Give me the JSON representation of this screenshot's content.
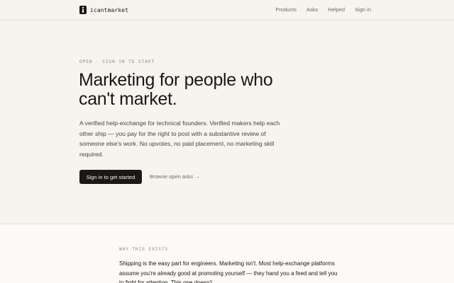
{
  "header": {
    "brand": "icantmarket",
    "logo_icon": "square-logo-icon",
    "nav": [
      {
        "label": "Products"
      },
      {
        "label": "Asks"
      },
      {
        "label": "Helped"
      },
      {
        "label": "Sign in"
      }
    ]
  },
  "hero": {
    "eyebrow": "OPEN · SIGN IN TO START",
    "headline": "Marketing for people who can't market.",
    "lede": "A verified help-exchange for technical founders. Verified makers help each other ship — you pay for the right to post with a substantive review of someone else's work. No upvotes, no paid placement, no marketing skill required.",
    "primary_cta": "Sign in to get started",
    "secondary_cta": "Browse open asks →"
  },
  "why": {
    "label": "WHY THIS EXISTS",
    "body": "Shipping is the easy part for engineers. Marketing isn't. Most help-exchange platforms assume you're already good at promoting yourself — they hand you a feed and tell you to fight for attention. This one doesn't."
  },
  "colors": {
    "background": "#f6f4ef",
    "ink": "#1a1815",
    "muted": "#6f6a61"
  }
}
